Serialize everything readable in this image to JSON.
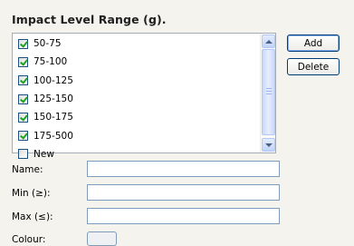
{
  "panel": {
    "title": "Impact Level Range (g)."
  },
  "ranges": [
    {
      "label": "50-75",
      "checked": true
    },
    {
      "label": "75-100",
      "checked": true
    },
    {
      "label": "100-125",
      "checked": true
    },
    {
      "label": "125-150",
      "checked": true
    },
    {
      "label": "150-175",
      "checked": true
    },
    {
      "label": "175-500",
      "checked": true
    },
    {
      "label": "New",
      "checked": false
    }
  ],
  "buttons": {
    "add": "Add",
    "delete": "Delete"
  },
  "form": {
    "name_label": "Name:",
    "name_value": "",
    "min_label": "Min (≥):",
    "min_value": "",
    "max_label": "Max (≤):",
    "max_value": "",
    "colour_label": "Colour:"
  }
}
